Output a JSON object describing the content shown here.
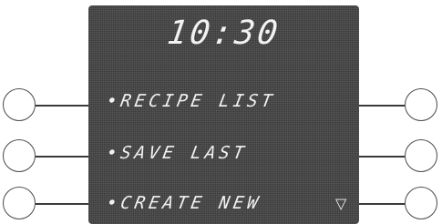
{
  "display": {
    "time": "10:30",
    "menu": [
      "•RECIPE LIST",
      "•SAVE LAST",
      "•CREATE NEW"
    ],
    "scroll_icon": "down-triangle-icon"
  },
  "colors": {
    "screen": "#3b3b3b",
    "text": "#f2f2f2",
    "outline": "#4a4a4a"
  }
}
